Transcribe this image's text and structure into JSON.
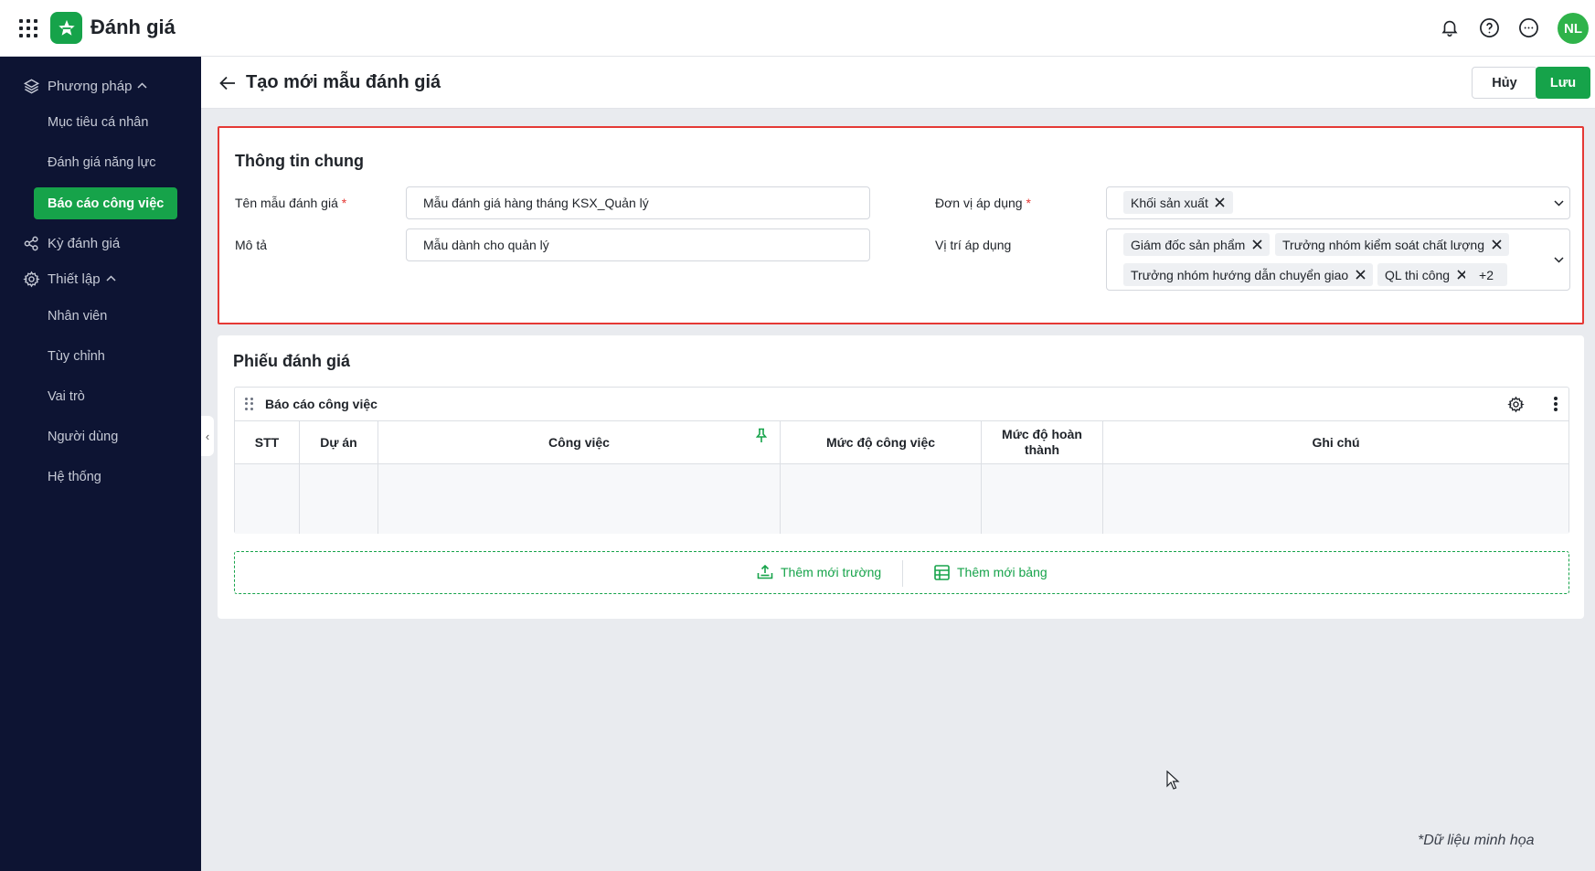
{
  "app": {
    "title": "Đánh giá",
    "avatar_initials": "NL",
    "brand_color": "#16a34a"
  },
  "sidebar": {
    "groups": [
      {
        "label": "Phương pháp",
        "icon": "layers-icon",
        "expanded": true,
        "items": [
          {
            "label": "Mục tiêu cá nhân",
            "active": false
          },
          {
            "label": "Đánh giá năng lực",
            "active": false
          },
          {
            "label": "Báo cáo công việc",
            "active": true
          }
        ]
      },
      {
        "label": "Kỳ đánh giá",
        "icon": "share-nodes-icon"
      },
      {
        "label": "Thiết lập",
        "icon": "gear-icon",
        "expanded": true,
        "items": [
          {
            "label": "Nhân viên"
          },
          {
            "label": "Tùy chỉnh"
          },
          {
            "label": "Vai trò"
          },
          {
            "label": "Người dùng"
          },
          {
            "label": "Hệ thống"
          }
        ]
      }
    ],
    "collapse_glyph": "‹"
  },
  "header": {
    "title": "Tạo mới mẫu đánh giá",
    "cancel_label": "Hủy",
    "save_label": "Lưu"
  },
  "general": {
    "title": "Thông tin chung",
    "template_name_label": "Tên mẫu đánh giá",
    "template_name_value": "Mẫu đánh giá hàng tháng KSX_Quản lý",
    "description_label": "Mô tả",
    "description_value": "Mẫu dành cho quản lý",
    "unit_label": "Đơn vị áp dụng",
    "unit_tags": [
      "Khối sản xuất"
    ],
    "position_label": "Vị trí áp dụng",
    "position_tags": [
      "Giám đốc sản phẩm",
      "Trưởng nhóm kiểm soát chất lượng",
      "Trưởng nhóm hướng dẫn chuyển giao",
      "QL thi công"
    ],
    "position_more": "+2",
    "required_mark": "*"
  },
  "evaluation": {
    "title": "Phiếu đánh giá",
    "table_name": "Báo cáo công việc",
    "columns": [
      "STT",
      "Dự án",
      "Công việc",
      "Mức độ công việc",
      "Mức độ hoàn thành",
      "Ghi chú"
    ],
    "add_field_label": "Thêm mới trường",
    "add_table_label": "Thêm mới bảng"
  },
  "footer_note": "*Dữ liệu minh họa"
}
